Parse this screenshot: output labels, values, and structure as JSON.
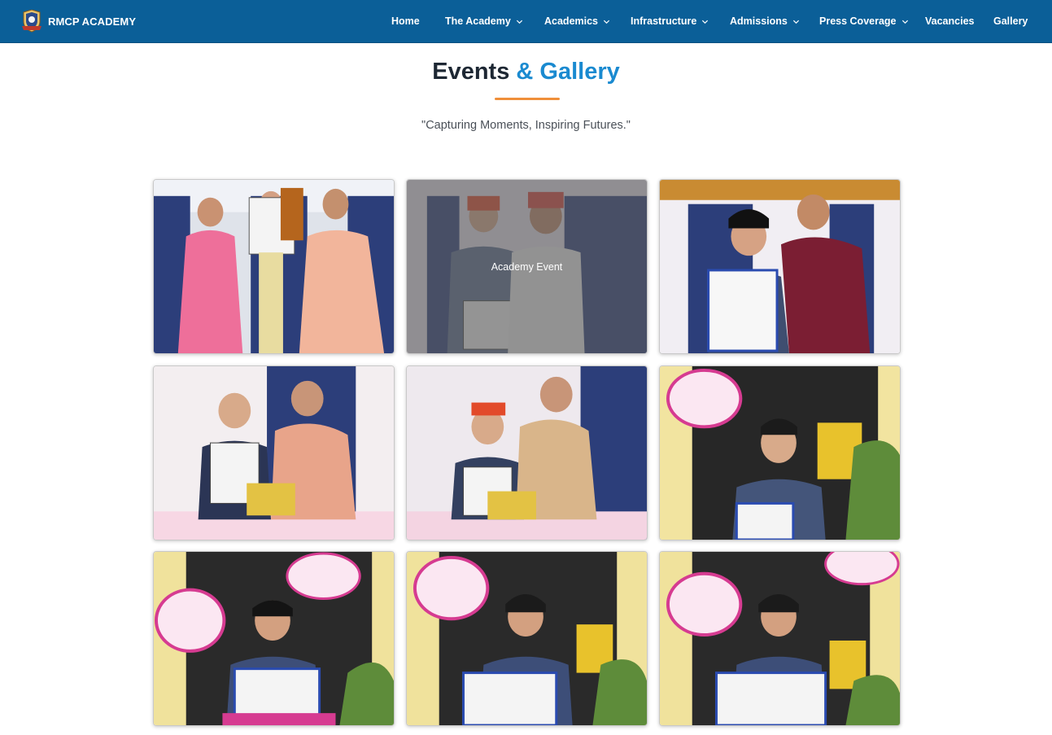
{
  "brand": {
    "name": "RMCP ACADEMY",
    "logo_icon": "academy-crest-icon"
  },
  "nav": {
    "items": [
      {
        "label": "Home",
        "dropdown": false
      },
      {
        "label": "The Academy",
        "dropdown": true
      },
      {
        "label": "Academics",
        "dropdown": true
      },
      {
        "label": "Infrastructure",
        "dropdown": true
      },
      {
        "label": "Admissions",
        "dropdown": true
      },
      {
        "label": "Press Coverage",
        "dropdown": true
      },
      {
        "label": "Vacancies",
        "dropdown": false
      },
      {
        "label": "Gallery",
        "dropdown": false
      }
    ]
  },
  "header": {
    "title_main": "Events",
    "title_accent": "& Gallery",
    "subtitle": "\"Capturing Moments, Inspiring Futures.\""
  },
  "gallery": {
    "hover_caption": "Academy Event",
    "photos": [
      {
        "name": "photo-1"
      },
      {
        "name": "photo-2"
      },
      {
        "name": "photo-3"
      },
      {
        "name": "photo-4"
      },
      {
        "name": "photo-5"
      },
      {
        "name": "photo-6"
      },
      {
        "name": "photo-7"
      },
      {
        "name": "photo-8"
      },
      {
        "name": "photo-9"
      }
    ]
  },
  "colors": {
    "navbar": "#0b5f98",
    "title_dark": "#1d2733",
    "title_accent": "#1a8ad0",
    "underline": "#ef8f3a"
  }
}
